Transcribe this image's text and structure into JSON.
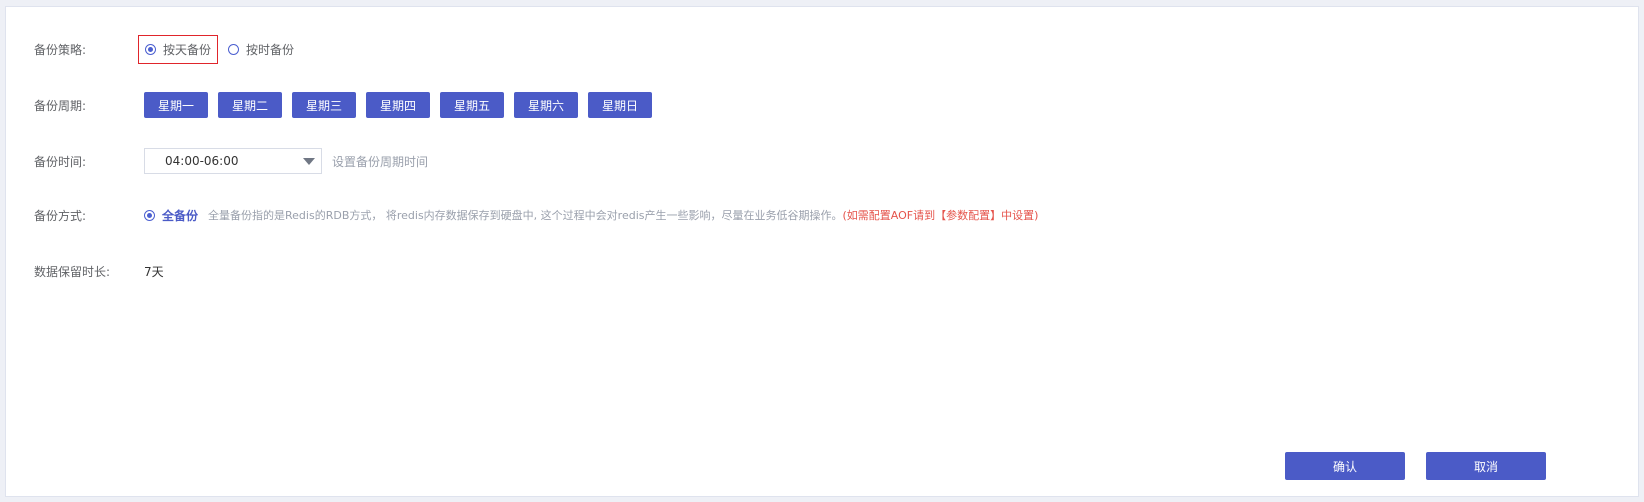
{
  "form": {
    "strategy": {
      "label": "备份策略:",
      "options": [
        {
          "label": "按天备份",
          "checked": true
        },
        {
          "label": "按时备份",
          "checked": false
        }
      ]
    },
    "cycle": {
      "label": "备份周期:",
      "days": [
        "星期一",
        "星期二",
        "星期三",
        "星期四",
        "星期五",
        "星期六",
        "星期日"
      ]
    },
    "time": {
      "label": "备份时间:",
      "value": "04:00-06:00",
      "hint": "设置备份周期时间"
    },
    "mode": {
      "label": "备份方式:",
      "option_label": "全备份",
      "description": "全量备份指的是Redis的RDB方式， 将redis内存数据保存到硬盘中, 这个过程中会对redis产生一些影响，尽量在业务低谷期操作。",
      "warning": "(如需配置AOF请到【参数配置】中设置)"
    },
    "retention": {
      "label": "数据保留时长:",
      "value": "7天"
    }
  },
  "footer": {
    "confirm_label": "确认",
    "cancel_label": "取消"
  },
  "colors": {
    "primary": "#4b5bc7",
    "warning": "#e5534b",
    "highlight_border": "#e0252b"
  }
}
